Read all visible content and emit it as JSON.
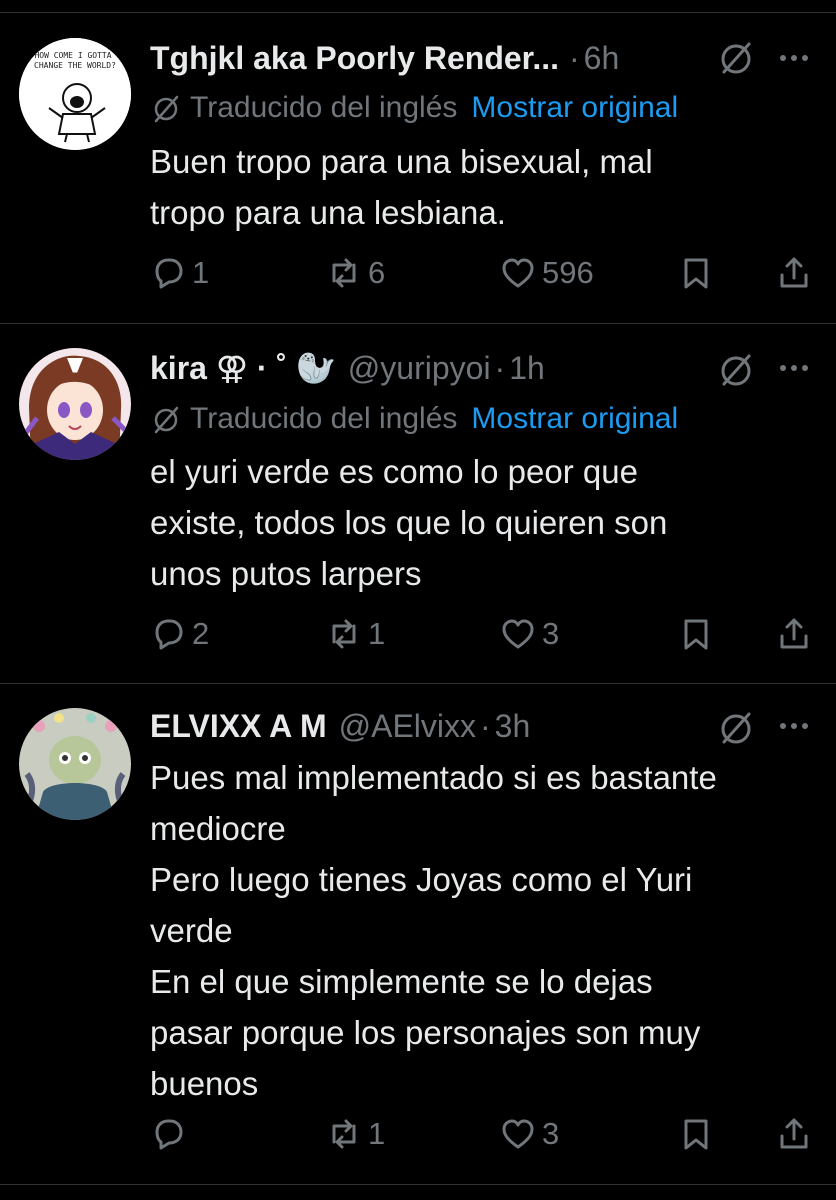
{
  "tweets": [
    {
      "display_name": "Tghjkl aka Poorly Render...",
      "handle": "",
      "separator": "·",
      "time": "6h",
      "translated_label": "Traducido del inglés",
      "show_original_label": "Mostrar original",
      "body_lines": [
        "Buen tropo para una bisexual, mal",
        "tropo para una lesbiana."
      ],
      "replies": "1",
      "reposts": "6",
      "likes": "596",
      "avatar_caption": "HOW COME I GOTTA CHANGE THE WORLD?"
    },
    {
      "display_name": "kira ⚢ · ˚ 🦭",
      "handle": "@yuripyoi",
      "separator": "·",
      "time": "1h",
      "translated_label": "Traducido del inglés",
      "show_original_label": "Mostrar original",
      "body_lines": [
        "el yuri verde es como lo peor que",
        "existe, todos los que lo quieren son",
        "unos putos larpers"
      ],
      "replies": "2",
      "reposts": "1",
      "likes": "3"
    },
    {
      "display_name": "ELVIXX A M",
      "handle": "@AElvixx",
      "separator": "·",
      "time": "3h",
      "body_lines": [
        "Pues mal implementado si es bastante",
        "mediocre",
        "Pero luego tienes Joyas como el Yuri",
        "verde",
        "En el que simplemente se lo dejas",
        "pasar porque los personajes son muy",
        "buenos"
      ],
      "replies": "",
      "reposts": "1",
      "likes": "3"
    }
  ],
  "colors": {
    "background": "#000000",
    "text": "#e7e9ea",
    "muted": "#71767b",
    "link": "#1d9bf0",
    "divider": "#2f3336"
  },
  "icons": [
    "grok-icon",
    "more-icon",
    "translate-icon",
    "reply-icon",
    "repost-icon",
    "like-icon",
    "bookmark-icon",
    "share-icon"
  ]
}
